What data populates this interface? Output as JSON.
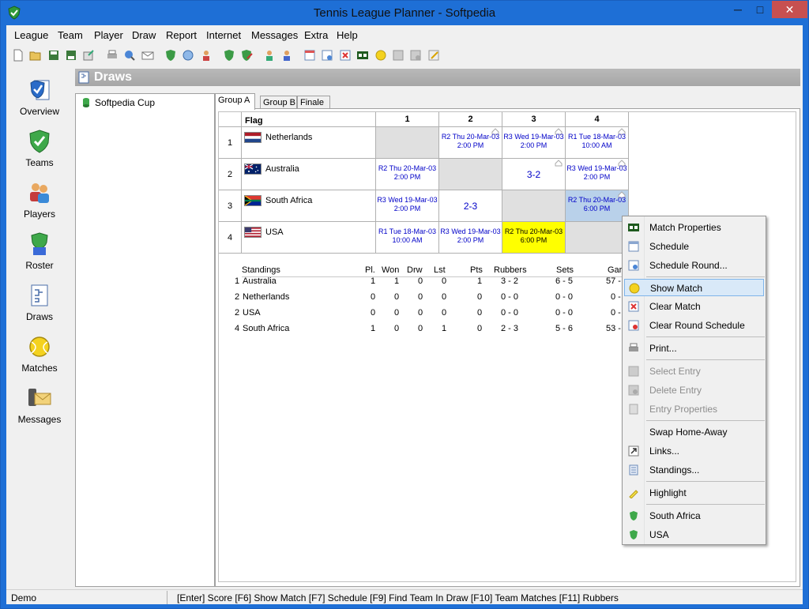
{
  "window": {
    "title": "Tennis League Planner - Softpedia",
    "minimize": "─",
    "maximize": "□",
    "close": "✕"
  },
  "menu": [
    "League",
    "Team",
    "Player",
    "Draw",
    "Report",
    "Internet",
    "Messages",
    "Extra",
    "Help"
  ],
  "toolbar_icons": [
    "new-icon",
    "open-icon",
    "save-icon",
    "save-as-icon",
    "export-icon",
    "print-icon",
    "preview-icon",
    "email-icon",
    "team-shield-icon",
    "globe-icon",
    "players-icon",
    "shield-add-icon",
    "shield-edit-icon",
    "person-icon",
    "person-group-icon",
    "calendar-icon",
    "schedule-icon",
    "clear-icon",
    "score-icon",
    "match-icon",
    "entry-icon",
    "entry-delete-icon",
    "edit-icon"
  ],
  "sidebar": [
    {
      "label": "Overview",
      "icon": "overview-icon"
    },
    {
      "label": "Teams",
      "icon": "teams-shield-icon"
    },
    {
      "label": "Players",
      "icon": "players-icon"
    },
    {
      "label": "Roster",
      "icon": "roster-icon"
    },
    {
      "label": "Draws",
      "icon": "draws-icon"
    },
    {
      "label": "Matches",
      "icon": "matches-ball-icon"
    },
    {
      "label": "Messages",
      "icon": "messages-envelope-icon"
    }
  ],
  "section_title": "Draws",
  "tree": {
    "items": [
      "Softpedia Cup"
    ]
  },
  "tabs": [
    "Group A",
    "Group B",
    "Finale"
  ],
  "grid": {
    "header_flag": "Flag",
    "columns": [
      "1",
      "2",
      "3",
      "4"
    ],
    "rows": [
      {
        "num": "1",
        "team": "Netherlands",
        "cells": [
          "",
          "R2 Thu 20-Mar-03\n2:00 PM",
          "R3 Wed 19-Mar-03\n2:00 PM",
          "R1 Tue 18-Mar-03\n10:00 AM"
        ]
      },
      {
        "num": "2",
        "team": "Australia",
        "cells": [
          "R2 Thu 20-Mar-03\n2:00 PM",
          "",
          "3-2",
          "R3 Wed 19-Mar-03\n2:00 PM"
        ]
      },
      {
        "num": "3",
        "team": "South Africa",
        "cells": [
          "R3 Wed 19-Mar-03\n2:00 PM",
          "2-3",
          "",
          "R2 Thu 20-Mar-03\n6:00 PM"
        ]
      },
      {
        "num": "4",
        "team": "USA",
        "cells": [
          "R1 Tue 18-Mar-03\n10:00 AM",
          "R3 Wed 19-Mar-03\n2:00 PM",
          "R2 Thu 20-Mar-03\n6:00 PM",
          ""
        ]
      }
    ]
  },
  "standings": {
    "headers": {
      "name": "Standings",
      "pl": "Pl.",
      "won": "Won",
      "drw": "Drw",
      "lst": "Lst",
      "pts": "Pts",
      "rubbers": "Rubbers",
      "sets": "Sets",
      "games": "Gar"
    },
    "rows": [
      {
        "rank": "1",
        "name": "Australia",
        "pl": "1",
        "won": "1",
        "drw": "0",
        "lst": "0",
        "pts": "1",
        "rubbers": "3 - 2",
        "sets": "6 - 5",
        "games": "57 -"
      },
      {
        "rank": "2",
        "name": "Netherlands",
        "pl": "0",
        "won": "0",
        "drw": "0",
        "lst": "0",
        "pts": "0",
        "rubbers": "0 - 0",
        "sets": "0 - 0",
        "games": "0 -"
      },
      {
        "rank": "2",
        "name": "USA",
        "pl": "0",
        "won": "0",
        "drw": "0",
        "lst": "0",
        "pts": "0",
        "rubbers": "0 - 0",
        "sets": "0 - 0",
        "games": "0 -"
      },
      {
        "rank": "4",
        "name": "South Africa",
        "pl": "1",
        "won": "0",
        "drw": "0",
        "lst": "1",
        "pts": "0",
        "rubbers": "2 - 3",
        "sets": "5 - 6",
        "games": "53 -"
      }
    ]
  },
  "context_menu": {
    "items": [
      {
        "label": "Match Properties",
        "icon": "score-board-icon",
        "state": "enabled"
      },
      {
        "label": "Schedule",
        "icon": "schedule-icon",
        "state": "enabled"
      },
      {
        "label": "Schedule Round...",
        "icon": "schedule-round-icon",
        "state": "enabled"
      },
      {
        "label": "Show Match",
        "icon": "tennis-ball-icon",
        "state": "hot"
      },
      {
        "label": "Clear Match",
        "icon": "clear-match-icon",
        "state": "enabled"
      },
      {
        "label": "Clear Round Schedule",
        "icon": "clear-round-icon",
        "state": "enabled"
      },
      {
        "label": "Print...",
        "icon": "print-icon",
        "state": "enabled"
      },
      {
        "label": "Select Entry",
        "icon": "select-entry-icon",
        "state": "disabled"
      },
      {
        "label": "Delete Entry",
        "icon": "delete-entry-icon",
        "state": "disabled"
      },
      {
        "label": "Entry Properties",
        "icon": "entry-properties-icon",
        "state": "disabled"
      },
      {
        "label": "Swap Home-Away",
        "icon": "",
        "state": "enabled"
      },
      {
        "label": "Links...",
        "icon": "link-icon",
        "state": "enabled"
      },
      {
        "label": "Standings...",
        "icon": "standings-icon",
        "state": "enabled"
      },
      {
        "label": "Highlight",
        "icon": "highlight-icon",
        "state": "enabled"
      },
      {
        "label": "South Africa",
        "icon": "team-shield-icon",
        "state": "enabled"
      },
      {
        "label": "USA",
        "icon": "team-shield-icon",
        "state": "enabled"
      }
    ]
  },
  "status": {
    "left": "Demo",
    "hints": "[Enter] Score  [F6] Show Match  [F7] Schedule  [F9] Find Team In Draw  [F10] Team Matches  [F11] Rubbers"
  },
  "colors": {
    "titlebar": "#1e6fd6",
    "close_button": "#c75050",
    "schedule_text": "#0000c8",
    "highlight_yellow": "#ffff00",
    "selected_cell": "#b9d1ea",
    "disabled_text": "#8d8d8d"
  }
}
